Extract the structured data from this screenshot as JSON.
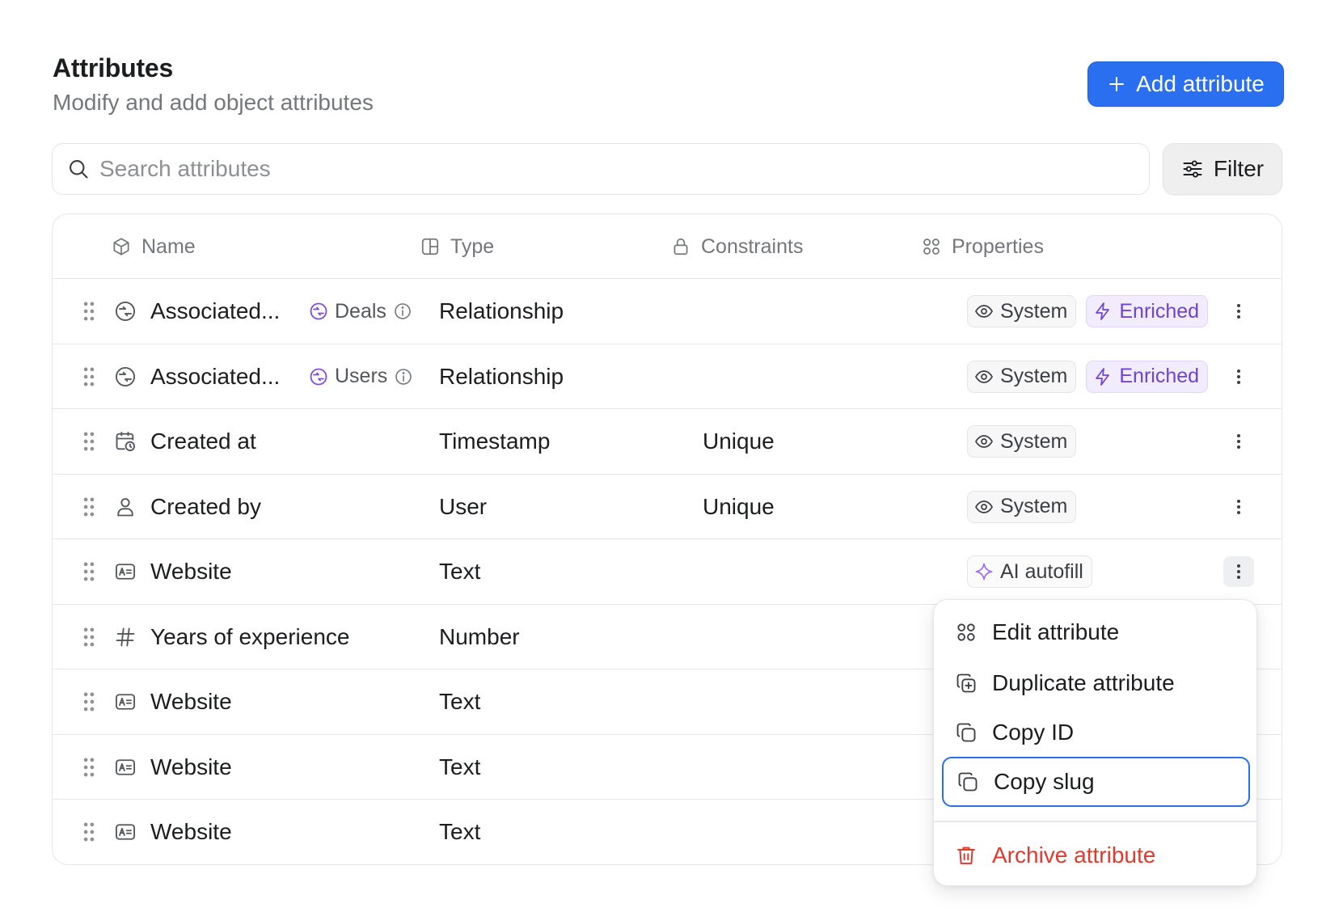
{
  "header": {
    "title": "Attributes",
    "subtitle": "Modify and add object attributes",
    "add_button": "Add attribute"
  },
  "search": {
    "placeholder": "Search attributes"
  },
  "filter_button": "Filter",
  "colors": {
    "accent": "#2a6ff0",
    "enriched": "#6f43d9",
    "danger": "#e33a2f",
    "relationship": "#7c4ddf"
  },
  "columns": {
    "name": "Name",
    "type": "Type",
    "constraints": "Constraints",
    "properties": "Properties"
  },
  "rows": [
    {
      "icon": "relationship-icon",
      "name": "Associated...",
      "related": "Deals",
      "type": "Relationship",
      "constraint": "",
      "badges": [
        "System",
        "Enriched"
      ]
    },
    {
      "icon": "relationship-icon",
      "name": "Associated...",
      "related": "Users",
      "type": "Relationship",
      "constraint": "",
      "badges": [
        "System",
        "Enriched"
      ]
    },
    {
      "icon": "calendar-clock-icon",
      "name": "Created at",
      "type": "Timestamp",
      "constraint": "Unique",
      "badges": [
        "System"
      ]
    },
    {
      "icon": "user-icon",
      "name": "Created by",
      "type": "User",
      "constraint": "Unique",
      "badges": [
        "System"
      ]
    },
    {
      "icon": "text-field-icon",
      "name": "Website",
      "type": "Text",
      "constraint": "",
      "badges": [
        "AI autofill"
      ]
    },
    {
      "icon": "hash-icon",
      "name": "Years of experience",
      "type": "Number",
      "constraint": "",
      "badges": []
    },
    {
      "icon": "text-field-icon",
      "name": "Website",
      "type": "Text",
      "constraint": "",
      "badges": []
    },
    {
      "icon": "text-field-icon",
      "name": "Website",
      "type": "Text",
      "constraint": "",
      "badges": []
    },
    {
      "icon": "text-field-icon",
      "name": "Website",
      "type": "Text",
      "constraint": "",
      "badges": []
    }
  ],
  "context_menu": {
    "items": [
      {
        "label": "Edit attribute",
        "icon": "grid-icon"
      },
      {
        "label": "Duplicate attribute",
        "icon": "duplicate-icon"
      },
      {
        "label": "Copy ID",
        "icon": "copy-icon"
      },
      {
        "label": "Copy slug",
        "icon": "copy-icon",
        "focused": true
      },
      {
        "label": "Archive attribute",
        "icon": "trash-icon",
        "danger": true
      }
    ]
  }
}
